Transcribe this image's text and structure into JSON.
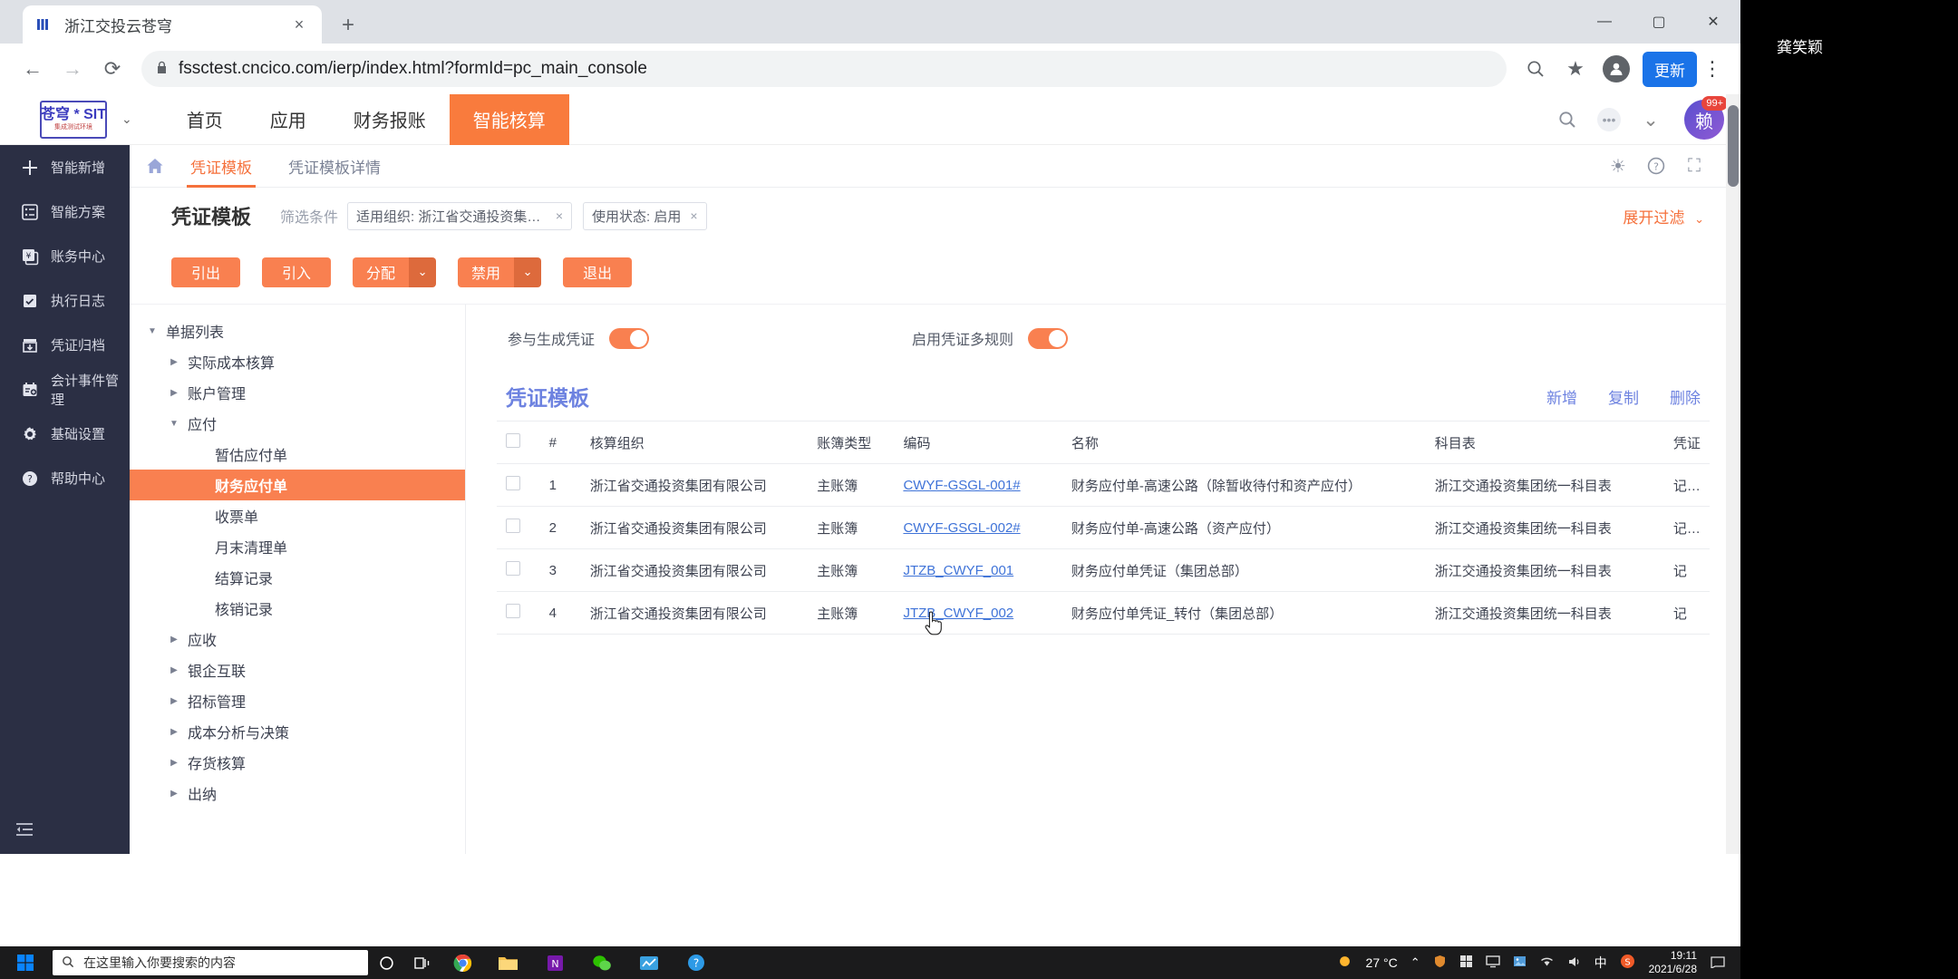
{
  "browser": {
    "tab": {
      "title": "浙江交投云苍穹",
      "favicon": "chrome-favicon-icon",
      "close": "×"
    },
    "new_tab": "+",
    "window_controls": {
      "minimize": "—",
      "maximize": "▢",
      "close": "✕"
    },
    "nav": {
      "back": "←",
      "forward": "→",
      "reload": "⟳"
    },
    "omnibox": {
      "lock": "lock-icon",
      "url": "fssctest.cncico.com/ierp/index.html?formId=pc_main_console"
    },
    "actions": {
      "zoom": "zoom-icon",
      "bookmark": "★",
      "profile": "profile-icon",
      "update_label": "更新",
      "menu": "⋮"
    }
  },
  "app": {
    "logo": {
      "main": "苍穹 * SIT",
      "sub": "集成测试环境",
      "caret": "⌄"
    },
    "nav_items": [
      {
        "label": "首页",
        "active": false
      },
      {
        "label": "应用",
        "active": false
      },
      {
        "label": "财务报账",
        "active": false
      },
      {
        "label": "智能核算",
        "active": true
      }
    ],
    "nav_right": {
      "search": "search-icon",
      "dots": "•••",
      "chevron": "⌄",
      "avatar_text": "赖",
      "badge": "99+"
    },
    "rail": [
      {
        "label": "智能新增",
        "icon": "plus-icon"
      },
      {
        "label": "智能方案",
        "icon": "list-icon"
      },
      {
        "label": "账务中心",
        "icon": "yuan-doc-icon"
      },
      {
        "label": "执行日志",
        "icon": "checklist-icon"
      },
      {
        "label": "凭证归档",
        "icon": "archive-download-icon"
      },
      {
        "label": "会计事件管理",
        "icon": "calendar-plus-icon"
      },
      {
        "label": "基础设置",
        "icon": "gear-icon"
      },
      {
        "label": "帮助中心",
        "icon": "question-circle-icon"
      }
    ],
    "rail_collapse": "collapse-icon",
    "breadcrumb": {
      "home_icon": "home-icon",
      "tabs": [
        {
          "label": "凭证模板",
          "active": true
        },
        {
          "label": "凭证模板详情",
          "active": false
        }
      ],
      "right_icons": [
        {
          "name": "theme-icon",
          "glyph": "☀"
        },
        {
          "name": "help-icon",
          "glyph": "?"
        },
        {
          "name": "fullscreen-icon",
          "glyph": "⛶"
        }
      ]
    },
    "page": {
      "title": "凭证模板",
      "filter_label": "筛选条件",
      "filters": [
        {
          "text": "适用组织: 浙江省交通投资集团有限公...",
          "remove": "×"
        },
        {
          "text": "使用状态: 启用",
          "remove": "×"
        }
      ],
      "expand_filter": "展开过滤",
      "expand_caret": "⌄",
      "toolbar_buttons": [
        {
          "label": "引出",
          "split": false
        },
        {
          "label": "引入",
          "split": false
        },
        {
          "label": "分配",
          "split": true
        },
        {
          "label": "禁用",
          "split": true
        },
        {
          "label": "退出",
          "split": false
        }
      ]
    },
    "tree": [
      {
        "label": "单据列表",
        "level": 0,
        "caret": "▼",
        "selected": false
      },
      {
        "label": "实际成本核算",
        "level": 1,
        "caret": "▶",
        "selected": false
      },
      {
        "label": "账户管理",
        "level": 1,
        "caret": "▶",
        "selected": false
      },
      {
        "label": "应付",
        "level": 1,
        "caret": "▼",
        "selected": false
      },
      {
        "label": "暂估应付单",
        "level": 2,
        "caret": "",
        "selected": false
      },
      {
        "label": "财务应付单",
        "level": 2,
        "caret": "",
        "selected": true
      },
      {
        "label": "收票单",
        "level": 2,
        "caret": "",
        "selected": false
      },
      {
        "label": "月末清理单",
        "level": 2,
        "caret": "",
        "selected": false
      },
      {
        "label": "结算记录",
        "level": 2,
        "caret": "",
        "selected": false
      },
      {
        "label": "核销记录",
        "level": 2,
        "caret": "",
        "selected": false
      },
      {
        "label": "应收",
        "level": 1,
        "caret": "▶",
        "selected": false
      },
      {
        "label": "银企互联",
        "level": 1,
        "caret": "▶",
        "selected": false
      },
      {
        "label": "招标管理",
        "level": 1,
        "caret": "▶",
        "selected": false
      },
      {
        "label": "成本分析与决策",
        "level": 1,
        "caret": "▶",
        "selected": false
      },
      {
        "label": "存货核算",
        "level": 1,
        "caret": "▶",
        "selected": false
      },
      {
        "label": "出纳",
        "level": 1,
        "caret": "▶",
        "selected": false
      }
    ],
    "panel": {
      "toggles": [
        {
          "label": "参与生成凭证",
          "on": true
        },
        {
          "label": "启用凭证多规则",
          "on": true
        }
      ],
      "title": "凭证模板",
      "actions": [
        {
          "label": "新增"
        },
        {
          "label": "复制"
        },
        {
          "label": "删除"
        }
      ],
      "table": {
        "columns": [
          "",
          "#",
          "核算组织",
          "账簿类型",
          "编码",
          "名称",
          "科目表",
          "凭证"
        ],
        "rows": [
          {
            "num": "1",
            "org": "浙江省交通投资集团有限公司",
            "book": "主账簿",
            "code": "CWYF-GSGL-001#",
            "name": "财务应付单-高速公路（除暂收待付和资产应付）",
            "subject": "浙江交通投资集团统一科目表",
            "voucher": "记/转"
          },
          {
            "num": "2",
            "org": "浙江省交通投资集团有限公司",
            "book": "主账簿",
            "code": "CWYF-GSGL-002#",
            "name": "财务应付单-高速公路（资产应付）",
            "subject": "浙江交通投资集团统一科目表",
            "voucher": "记/转"
          },
          {
            "num": "3",
            "org": "浙江省交通投资集团有限公司",
            "book": "主账簿",
            "code": "JTZB_CWYF_001",
            "name": "财务应付单凭证（集团总部）",
            "subject": "浙江交通投资集团统一科目表",
            "voucher": "记"
          },
          {
            "num": "4",
            "org": "浙江省交通投资集团有限公司",
            "book": "主账簿",
            "code": "JTZB_CWYF_002",
            "name": "财务应付单凭证_转付（集团总部）",
            "subject": "浙江交通投资集团统一科目表",
            "voucher": "记"
          }
        ]
      }
    }
  },
  "desktop": {
    "watermark": "龚笑颖",
    "taskbar": {
      "start": "start-icon",
      "search_placeholder": "在这里输入你要搜索的内容",
      "search_icon": "search-icon",
      "icons": [
        {
          "name": "cortana-icon"
        },
        {
          "name": "task-view-icon"
        },
        {
          "name": "chrome-icon"
        },
        {
          "name": "file-explorer-icon"
        },
        {
          "name": "onenote-icon"
        },
        {
          "name": "wechat-icon"
        },
        {
          "name": "chart-app-icon"
        },
        {
          "name": "help-app-icon"
        }
      ],
      "weather": {
        "icon": "sun-icon",
        "temp": "27 °C"
      },
      "tray": {
        "chevron": "⌃",
        "icons": [
          "shield-icon",
          "network-icon",
          "grid-icon",
          "monitor-icon",
          "photo-icon",
          "wifi-icon",
          "volume-icon"
        ],
        "ime": "中",
        "ime2": "S"
      },
      "clock": {
        "time": "19:11",
        "date": "2021/6/28"
      },
      "notification": "notification-icon"
    }
  }
}
